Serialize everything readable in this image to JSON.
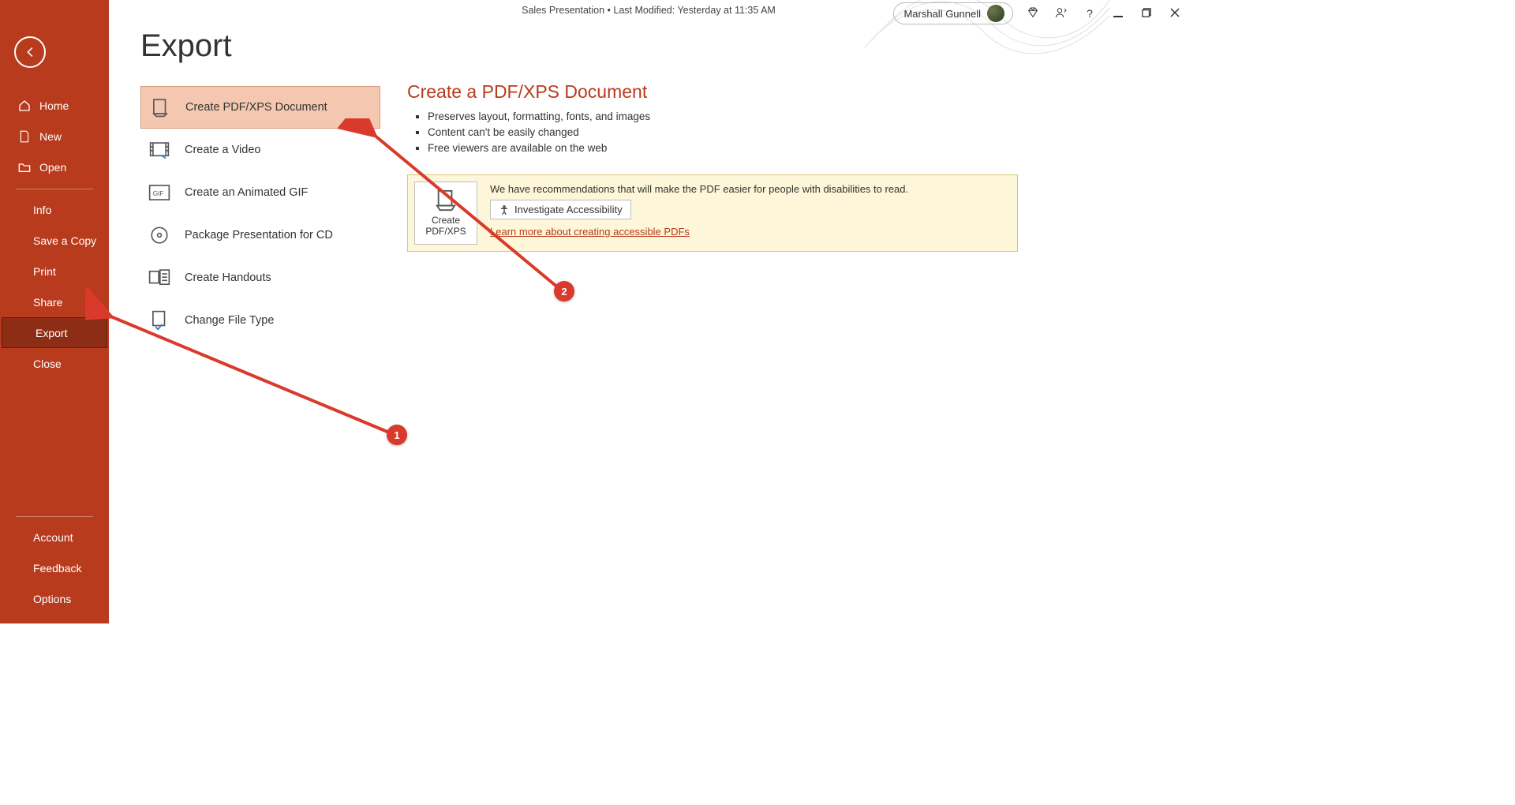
{
  "topbar": {
    "title": "Sales Presentation • Last Modified: Yesterday at 11:35 AM",
    "user": "Marshall Gunnell",
    "help": "?"
  },
  "sidebar": {
    "home": "Home",
    "new": "New",
    "open": "Open",
    "info": "Info",
    "save_copy": "Save a Copy",
    "print": "Print",
    "share": "Share",
    "export": "Export",
    "close": "Close",
    "account": "Account",
    "feedback": "Feedback",
    "options": "Options"
  },
  "page": {
    "title": "Export"
  },
  "export_options": {
    "pdf": "Create PDF/XPS Document",
    "video": "Create a Video",
    "gif": "Create an Animated GIF",
    "cd": "Package Presentation for CD",
    "handouts": "Create Handouts",
    "change_type": "Change File Type"
  },
  "detail": {
    "title": "Create a PDF/XPS Document",
    "b1": "Preserves layout, formatting, fonts, and images",
    "b2": "Content can't be easily changed",
    "b3": "Free viewers are available on the web"
  },
  "reco": {
    "text": "We have recommendations that will make the PDF easier for people with disabilities to read.",
    "investigate": "Investigate Accessibility",
    "create_line1": "Create",
    "create_line2": "PDF/XPS",
    "link": "Learn more about creating accessible PDFs"
  },
  "anno": {
    "b1": "1",
    "b2": "2"
  }
}
